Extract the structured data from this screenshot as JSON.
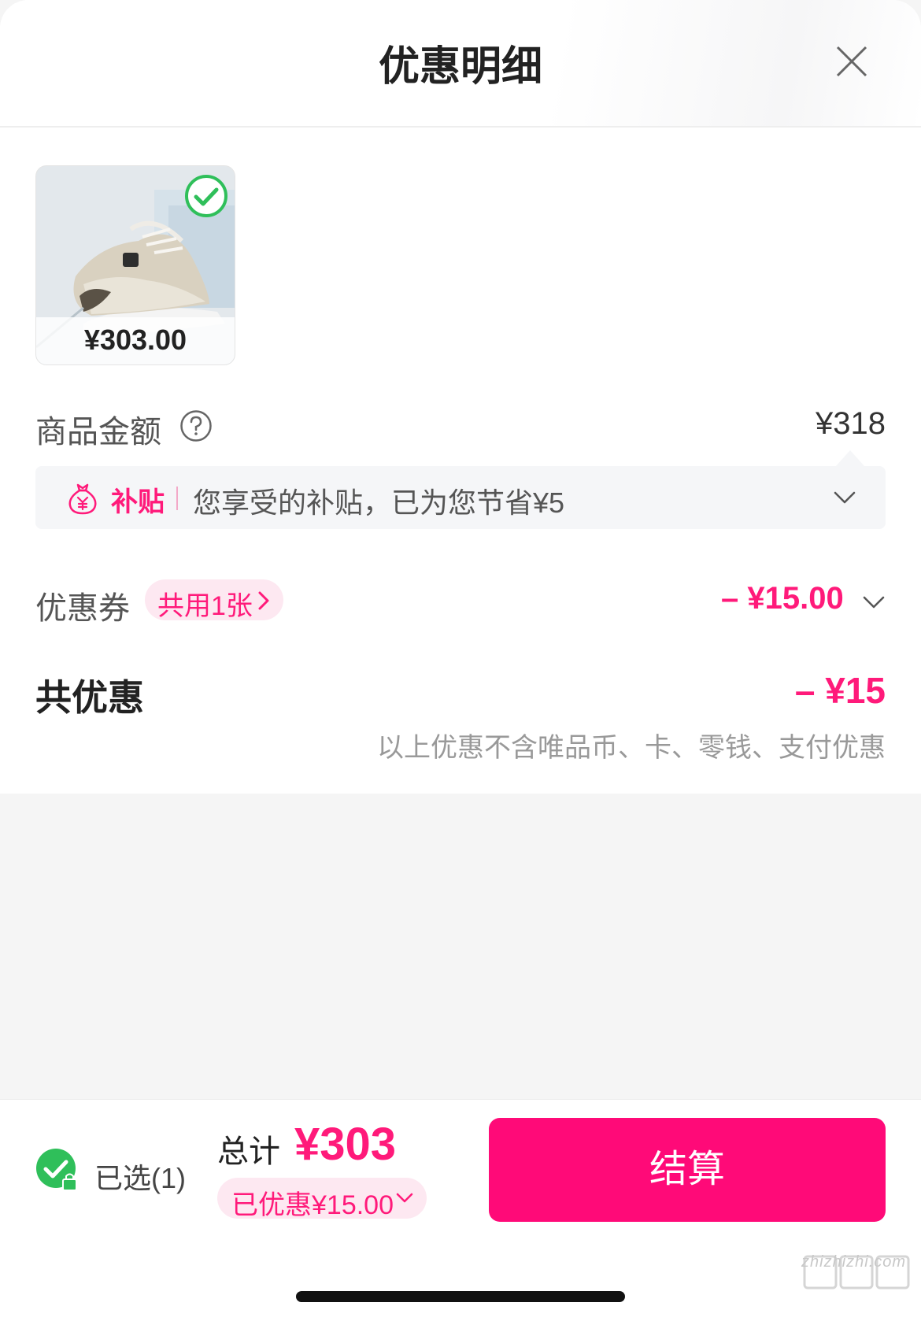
{
  "header": {
    "title": "优惠明细"
  },
  "product": {
    "price": "¥303.00"
  },
  "goods_amount": {
    "label": "商品金额",
    "value": "¥318"
  },
  "subsidy": {
    "tag": "补贴",
    "text": "您享受的补贴，已为您节省¥5"
  },
  "coupon": {
    "label": "优惠券",
    "chip": "共用1张",
    "value": "– ¥15.00"
  },
  "total_discount": {
    "label": "共优惠",
    "value": "– ¥15",
    "note": "以上优惠不含唯品币、卡、零钱、支付优惠"
  },
  "bottom": {
    "selected": "已选(1)",
    "total_label": "总计",
    "total_value": "¥303",
    "discount_pill": "已优惠¥15.00",
    "checkout": "结算"
  },
  "watermark": "zhizhizhi.com",
  "colors": {
    "accent": "#ff0a78",
    "accent_text": "#ff1a7a",
    "check_green": "#2fbf5a"
  }
}
